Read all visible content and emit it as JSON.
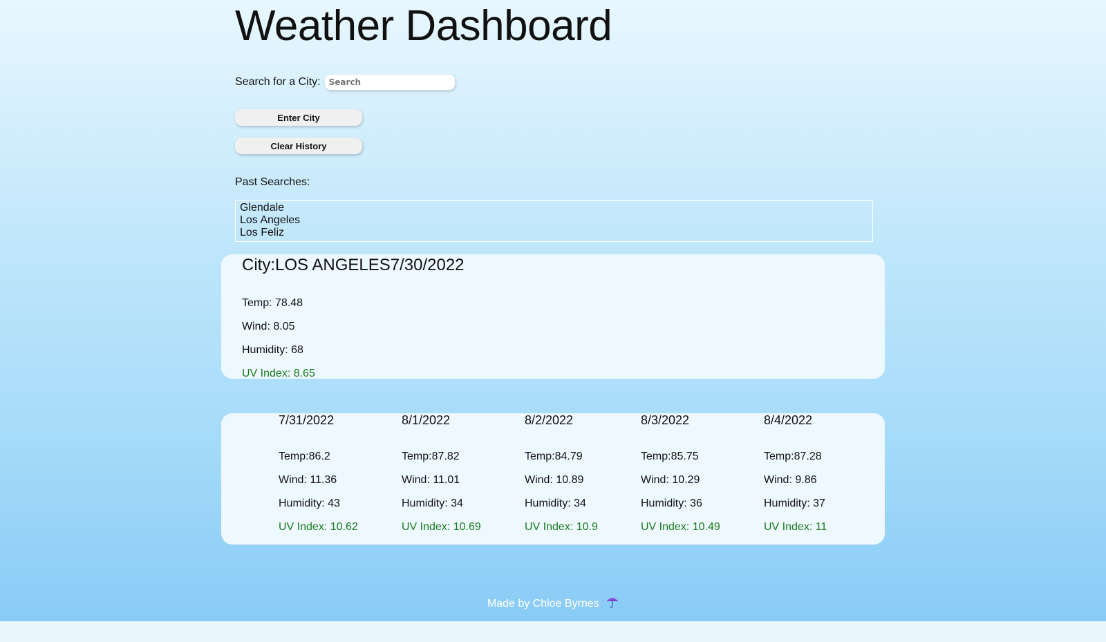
{
  "header": {
    "title": "Weather Dashboard"
  },
  "search": {
    "label": "Search for a City:",
    "placeholder": "Search",
    "value": ""
  },
  "buttons": {
    "enter": "Enter City",
    "clear": "Clear History"
  },
  "history": {
    "label": "Past Searches:",
    "items": [
      "Glendale",
      "Los Angeles",
      "Los Feliz"
    ]
  },
  "current": {
    "title": "City:LOS ANGELES7/30/2022",
    "temp": "Temp: 78.48",
    "wind": "Wind: 8.05",
    "humidity": "Humidity: 68",
    "uv": "UV Index: 8.65"
  },
  "forecast": [
    {
      "date": "7/31/2022",
      "temp": "Temp:86.2",
      "wind": "Wind: 11.36",
      "humidity": "Humidity: 43",
      "uv": "UV Index: 10.62"
    },
    {
      "date": "8/1/2022",
      "temp": "Temp:87.82",
      "wind": "Wind: 11.01",
      "humidity": "Humidity: 34",
      "uv": "UV Index: 10.69"
    },
    {
      "date": "8/2/2022",
      "temp": "Temp:84.79",
      "wind": "Wind: 10.89",
      "humidity": "Humidity: 34",
      "uv": "UV Index: 10.9"
    },
    {
      "date": "8/3/2022",
      "temp": "Temp:85.75",
      "wind": "Wind: 10.29",
      "humidity": "Humidity: 36",
      "uv": "UV Index: 10.49"
    },
    {
      "date": "8/4/2022",
      "temp": "Temp:87.28",
      "wind": "Wind: 9.86",
      "humidity": "Humidity: 37",
      "uv": "UV Index: 11"
    }
  ],
  "footer": {
    "text": "Made by Chloe Byrnes",
    "icon": "umbrella-icon"
  },
  "colors": {
    "uv_text": "#1a7a1a",
    "card_bg": "#eef8ff",
    "footer_text": "#ffffff"
  }
}
